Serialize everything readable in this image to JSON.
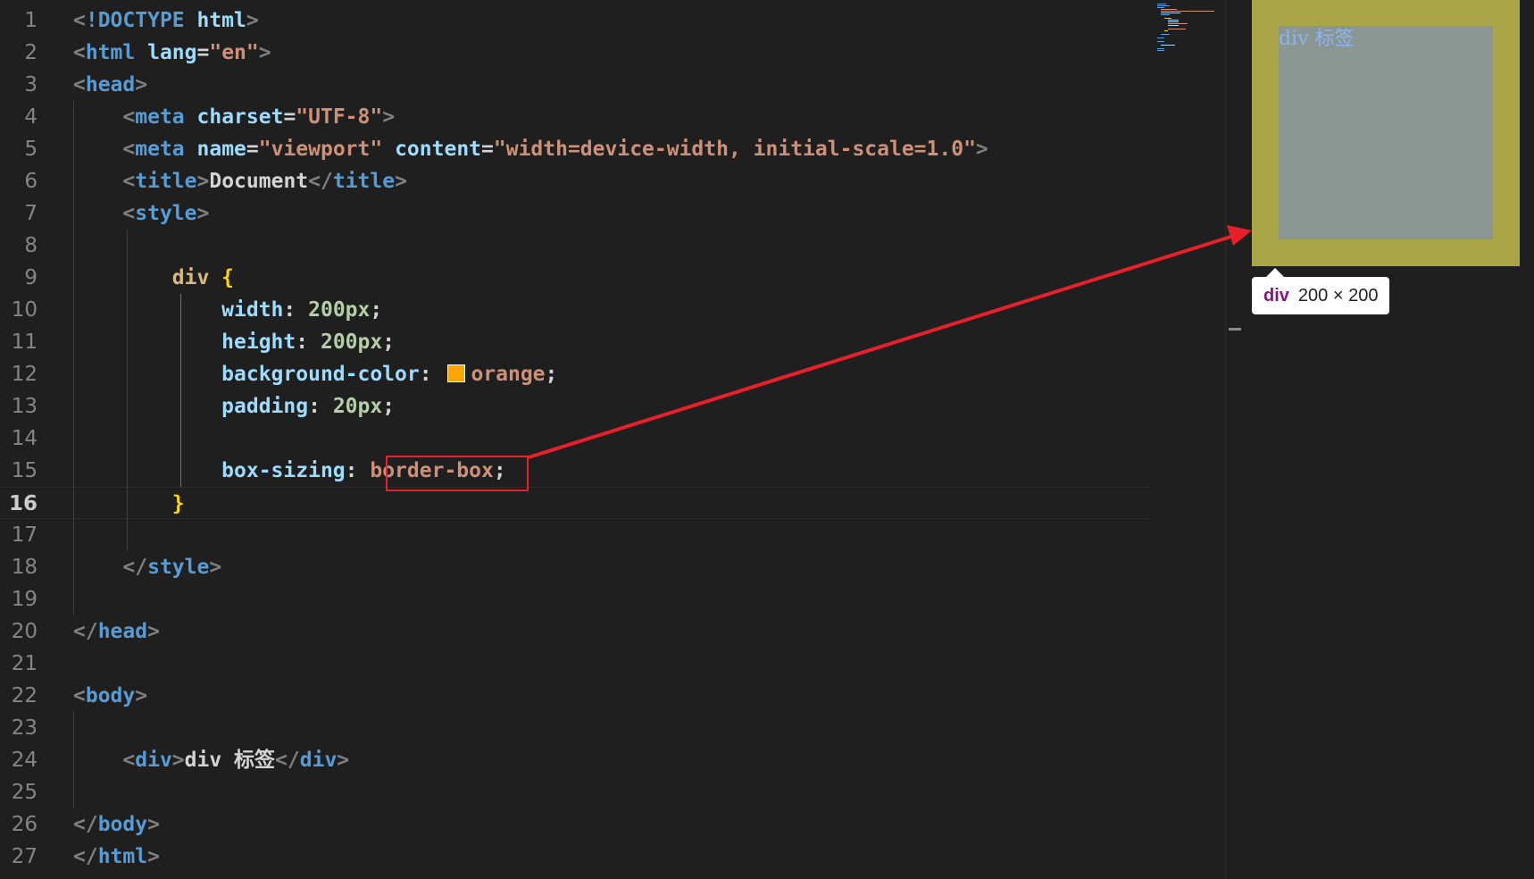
{
  "editor": {
    "lines": [
      {
        "n": "1",
        "tokens": [
          [
            "t-pun",
            "<"
          ],
          [
            "t-tag",
            "!DOCTYPE "
          ],
          [
            "t-attr",
            "html"
          ],
          [
            "t-pun",
            ">"
          ]
        ]
      },
      {
        "n": "2",
        "tokens": [
          [
            "t-pun",
            "<"
          ],
          [
            "t-tag",
            "html "
          ],
          [
            "t-attr",
            "lang"
          ],
          [
            "t-txt",
            "="
          ],
          [
            "t-str",
            "\"en\""
          ],
          [
            "t-pun",
            ">"
          ]
        ]
      },
      {
        "n": "3",
        "tokens": [
          [
            "t-pun",
            "<"
          ],
          [
            "t-tag",
            "head"
          ],
          [
            "t-pun",
            ">"
          ]
        ]
      },
      {
        "n": "4",
        "tokens": [
          [
            "t-pun",
            "    <"
          ],
          [
            "t-tag",
            "meta "
          ],
          [
            "t-attr",
            "charset"
          ],
          [
            "t-txt",
            "="
          ],
          [
            "t-str",
            "\"UTF-8\""
          ],
          [
            "t-pun",
            ">"
          ]
        ]
      },
      {
        "n": "5",
        "tokens": [
          [
            "t-pun",
            "    <"
          ],
          [
            "t-tag",
            "meta "
          ],
          [
            "t-attr",
            "name"
          ],
          [
            "t-txt",
            "="
          ],
          [
            "t-str",
            "\"viewport\" "
          ],
          [
            "t-attr",
            "content"
          ],
          [
            "t-txt",
            "="
          ],
          [
            "t-str",
            "\"width=device-width, initial-scale=1.0\""
          ],
          [
            "t-pun",
            ">"
          ]
        ]
      },
      {
        "n": "6",
        "tokens": [
          [
            "t-pun",
            "    <"
          ],
          [
            "t-tag",
            "title"
          ],
          [
            "t-pun",
            ">"
          ],
          [
            "t-txt",
            "Document"
          ],
          [
            "t-pun",
            "</"
          ],
          [
            "t-tag",
            "title"
          ],
          [
            "t-pun",
            ">"
          ]
        ]
      },
      {
        "n": "7",
        "tokens": [
          [
            "t-pun",
            "    <"
          ],
          [
            "t-tag",
            "style"
          ],
          [
            "t-pun",
            ">"
          ]
        ]
      },
      {
        "n": "8",
        "tokens": []
      },
      {
        "n": "9",
        "tokens": [
          [
            "t-txt",
            "        "
          ],
          [
            "t-sel",
            "div "
          ],
          [
            "t-brace",
            "{"
          ]
        ]
      },
      {
        "n": "10",
        "tokens": [
          [
            "t-txt",
            "            "
          ],
          [
            "t-prop",
            "width"
          ],
          [
            "t-txt",
            ": "
          ],
          [
            "t-num",
            "200px"
          ],
          [
            "t-txt",
            ";"
          ]
        ]
      },
      {
        "n": "11",
        "tokens": [
          [
            "t-txt",
            "            "
          ],
          [
            "t-prop",
            "height"
          ],
          [
            "t-txt",
            ": "
          ],
          [
            "t-num",
            "200px"
          ],
          [
            "t-txt",
            ";"
          ]
        ]
      },
      {
        "n": "12",
        "tokens": [
          [
            "t-txt",
            "            "
          ],
          [
            "t-prop",
            "background-color"
          ],
          [
            "t-txt",
            ": "
          ],
          [
            "swatch",
            "#ffa500"
          ],
          [
            "t-val",
            "orange"
          ],
          [
            "t-txt",
            ";"
          ]
        ]
      },
      {
        "n": "13",
        "tokens": [
          [
            "t-txt",
            "            "
          ],
          [
            "t-prop",
            "padding"
          ],
          [
            "t-txt",
            ": "
          ],
          [
            "t-num",
            "20px"
          ],
          [
            "t-txt",
            ";"
          ]
        ]
      },
      {
        "n": "14",
        "tokens": []
      },
      {
        "n": "15",
        "tokens": [
          [
            "t-txt",
            "            "
          ],
          [
            "t-prop",
            "box-sizing"
          ],
          [
            "t-txt",
            ": "
          ],
          [
            "t-val",
            "border-box"
          ],
          [
            "t-txt",
            ";"
          ]
        ]
      },
      {
        "n": "16",
        "tokens": [
          [
            "t-txt",
            "        "
          ],
          [
            "t-brace",
            "}"
          ]
        ]
      },
      {
        "n": "17",
        "tokens": []
      },
      {
        "n": "18",
        "tokens": [
          [
            "t-pun",
            "    </"
          ],
          [
            "t-tag",
            "style"
          ],
          [
            "t-pun",
            ">"
          ]
        ]
      },
      {
        "n": "19",
        "tokens": []
      },
      {
        "n": "20",
        "tokens": [
          [
            "t-pun",
            "</"
          ],
          [
            "t-tag",
            "head"
          ],
          [
            "t-pun",
            ">"
          ]
        ]
      },
      {
        "n": "21",
        "tokens": []
      },
      {
        "n": "22",
        "tokens": [
          [
            "t-pun",
            "<"
          ],
          [
            "t-tag",
            "body"
          ],
          [
            "t-pun",
            ">"
          ]
        ]
      },
      {
        "n": "23",
        "tokens": []
      },
      {
        "n": "24",
        "tokens": [
          [
            "t-pun",
            "    <"
          ],
          [
            "t-tag",
            "div"
          ],
          [
            "t-pun",
            ">"
          ],
          [
            "t-txt",
            "div 标签"
          ],
          [
            "t-pun",
            "</"
          ],
          [
            "t-tag",
            "div"
          ],
          [
            "t-pun",
            ">"
          ]
        ]
      },
      {
        "n": "25",
        "tokens": []
      },
      {
        "n": "26",
        "tokens": [
          [
            "t-pun",
            "</"
          ],
          [
            "t-tag",
            "body"
          ],
          [
            "t-pun",
            ">"
          ]
        ]
      },
      {
        "n": "27",
        "tokens": [
          [
            "t-pun",
            "</"
          ],
          [
            "t-tag",
            "html"
          ],
          [
            "t-pun",
            ">"
          ]
        ]
      }
    ],
    "current_line": "16"
  },
  "preview": {
    "div_text": "div 标签",
    "tooltip_tag": "div",
    "tooltip_size": "200 × 200",
    "colors": {
      "padding_area": "#aaa647",
      "content_area": "#8a9692"
    }
  },
  "annotation": {
    "color": "#e8202a"
  }
}
